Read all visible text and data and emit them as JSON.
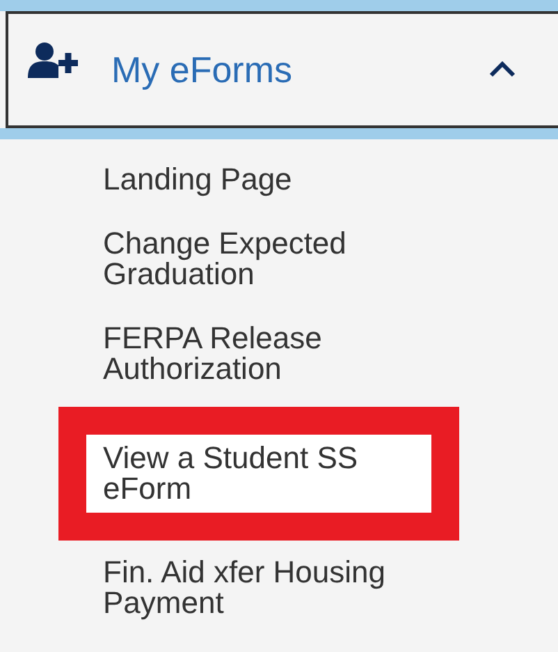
{
  "header": {
    "title": "My eForms",
    "expanded": true
  },
  "items": [
    {
      "label": "Landing Page",
      "highlighted": false
    },
    {
      "label": "Change Expected Graduation",
      "highlighted": false
    },
    {
      "label": "FERPA Release Authorization",
      "highlighted": false
    },
    {
      "label": "View a Student SS eForm",
      "highlighted": true
    },
    {
      "label": "Fin. Aid xfer Housing Payment",
      "highlighted": false
    }
  ]
}
